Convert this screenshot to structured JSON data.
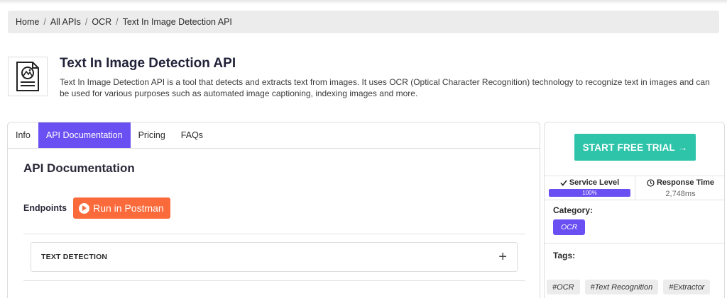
{
  "breadcrumb": [
    "Home",
    "All APIs",
    "OCR",
    "Text In Image Detection API"
  ],
  "api": {
    "title": "Text In Image Detection API",
    "description": "Text In Image Detection API is a tool that detects and extracts text from images. It uses OCR (Optical Character Recognition) technology to recognize text in images and can be used for various purposes such as automated image captioning, indexing images and more."
  },
  "tabs": [
    "Info",
    "API Documentation",
    "Pricing",
    "FAQs"
  ],
  "active_tab": "API Documentation",
  "documentation": {
    "heading": "API Documentation",
    "endpoints_label": "Endpoints",
    "postman_label": "Run in Postman",
    "endpoint": {
      "name": "TEXT DETECTION",
      "toggle": "+"
    }
  },
  "sidebar": {
    "trial_button": "START FREE TRIAL →",
    "service_level": {
      "label": "Service Level",
      "value": "100%",
      "fraction": 1.0
    },
    "response_time": {
      "label": "Response Time",
      "value": "2,748ms"
    },
    "category_label": "Category:",
    "category": "OCR",
    "tags_label": "Tags:",
    "tags": [
      "#OCR",
      "#Text Recognition",
      "#Extractor"
    ]
  },
  "colors": {
    "accent": "#6a50f2",
    "trial": "#2ec4aa",
    "postman": "#fa6a3b"
  },
  "icons": [
    "document-image-icon",
    "check-icon",
    "clock-icon",
    "play-icon",
    "plus-icon"
  ]
}
